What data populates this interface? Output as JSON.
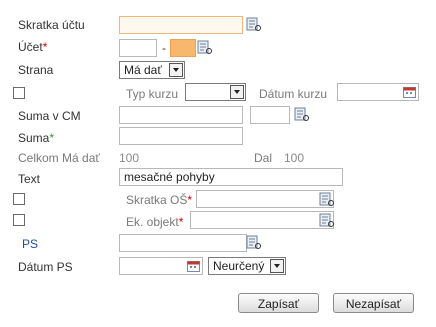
{
  "form": {
    "skratka_uctu_label": "Skratka účtu",
    "ucet_label": "Účet",
    "ucet_separator": "-",
    "strana_label": "Strana",
    "strana_value": "Má dať",
    "typ_kurzu_label": "Typ kurzu",
    "datum_kurzu_label": "Dátum kurzu",
    "suma_v_cm_label": "Suma v CM",
    "suma_label": "Suma",
    "celkom_ma_dat_label": "Celkom Má dať",
    "celkom_ma_dat_value": "100",
    "dal_label": "Dal",
    "dal_value": "100",
    "text_label": "Text",
    "text_value": "mesačné pohyby",
    "skratka_os_label": "Skratka OŠ",
    "ek_objekt_label": "Ek. objekt",
    "ps_label": "PS",
    "datum_ps_label": "Dátum PS",
    "datum_ps_select_value": "Neurčený",
    "required_mark": "*"
  },
  "buttons": {
    "zapisat": "Zapísať",
    "nezapisat": "Nezapísať"
  },
  "colors": {
    "required": "#cc0000",
    "required_green": "#2d9a2d",
    "focused_border": "#f1b778",
    "orange_field": "#f7b86e",
    "ps_label": "#1f4e9c"
  },
  "icons": {
    "lookup": "lookup-icon",
    "calendar": "calendar-icon",
    "dropdown": "chevron-down-icon"
  }
}
